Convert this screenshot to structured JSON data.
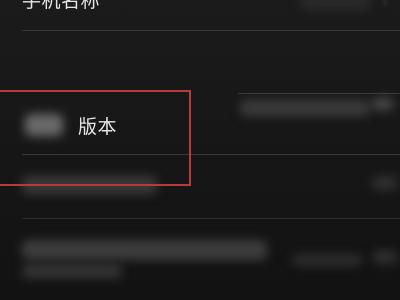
{
  "settings": {
    "rows": [
      {
        "id": "phone-name",
        "label": "手机名称"
      },
      {
        "id": "version",
        "label": "版本"
      }
    ]
  },
  "colors": {
    "background": "#141414",
    "divider": "#3a3a3a",
    "text": "#e6e6e6",
    "highlight": "#b73b3b"
  }
}
